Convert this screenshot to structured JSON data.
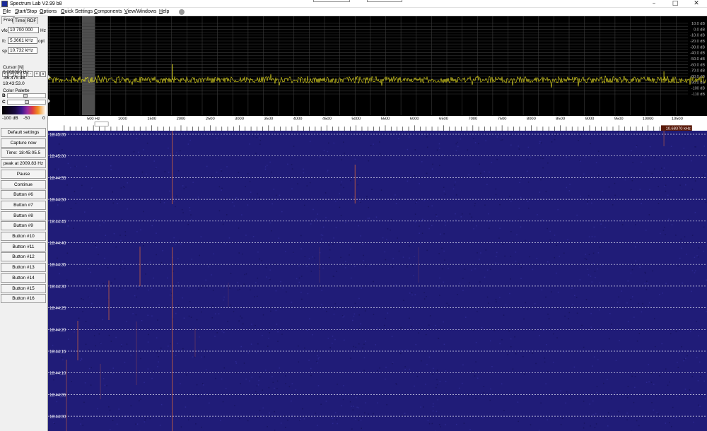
{
  "titlebar": {
    "title": "Spectrum Lab V2.99 b8"
  },
  "menu": [
    {
      "key": "F",
      "rest": "ile"
    },
    {
      "key": "S",
      "rest": "tart/Stop"
    },
    {
      "key": "O",
      "rest": "ptions"
    },
    {
      "key": "Q",
      "rest": "uick Settings"
    },
    {
      "key": "C",
      "rest": "omponents"
    },
    {
      "key": "V",
      "rest": "iew/Windows"
    },
    {
      "key": "H",
      "rest": "elp"
    }
  ],
  "tabs": [
    "Freq",
    "Time",
    "RDF"
  ],
  "freq": {
    "vfo_label": "vfo",
    "vfo_value": "10 700 000",
    "vfo_unit": "Hz",
    "fc_label": "fc",
    "fc_value": "5.3661 kHz",
    "fc_unit": "opt",
    "sp_label": "sp",
    "sp_value": "10.732 kHz"
  },
  "step_buttons": [
    "<",
    ">",
    "<",
    ">",
    "-",
    "+",
    "v"
  ],
  "cursor": {
    "title": "Cursor [N]",
    "freq": "0.000000 Hz",
    "level": "-86.475 dB",
    "time": "18:43:53.0"
  },
  "palette": {
    "title": "Color Palette",
    "b_label": "B",
    "c_label": "C",
    "scale_min": "-100 dB",
    "scale_mid": "-50",
    "scale_max": "0"
  },
  "buttons": [
    "Default settings",
    "Capture now",
    "Time:  18:45:05.5",
    "peak at 2009.83 Hz",
    "Pause",
    "Continue",
    "Button #6",
    "Button #7",
    "Button #8",
    "Button #9",
    "Button #10",
    "Button #11",
    "Button #12",
    "Button #13",
    "Button #14",
    "Button #15",
    "Button #16"
  ],
  "spectrum": {
    "db_labels": [
      "10.0 dB",
      "0.0 dB",
      "-10.0 dB",
      "-20.0 dB",
      "-30.0 dB",
      "-40.0 dB",
      "-50.0 dB",
      "-60.0 dB",
      "-70.0 dB",
      "-80.0 dB",
      "-90.0 dB",
      "-100 dB",
      "-110 dB"
    ],
    "noise_floor_db": -86,
    "peak_hz": 2009.83,
    "colors": {
      "trace": "#e8e020",
      "grid": "#3a3a3a",
      "background": "#000000"
    }
  },
  "freq_axis": {
    "labels": [
      "500 Hz",
      "1000",
      "1500",
      "2000",
      "2500",
      "3000",
      "3500",
      "4000",
      "4500",
      "5000",
      "5500",
      "6000",
      "6500",
      "7000",
      "7500",
      "8000",
      "8500",
      "9000",
      "9500",
      "10000",
      "10500"
    ],
    "end_marker": "10.68370 kHz"
  },
  "waterfall": {
    "time_labels": [
      "18:45:05",
      "18:45:00",
      "18:44:55",
      "18:44:50",
      "18:44:45",
      "18:44:40",
      "18:44:35",
      "18:44:30",
      "18:44:25",
      "18:44:20",
      "18:44:15",
      "18:44:10",
      "18:44:05",
      "18:44:00"
    ],
    "colors": {
      "background": "#201c78",
      "trace": "#c86040"
    }
  }
}
